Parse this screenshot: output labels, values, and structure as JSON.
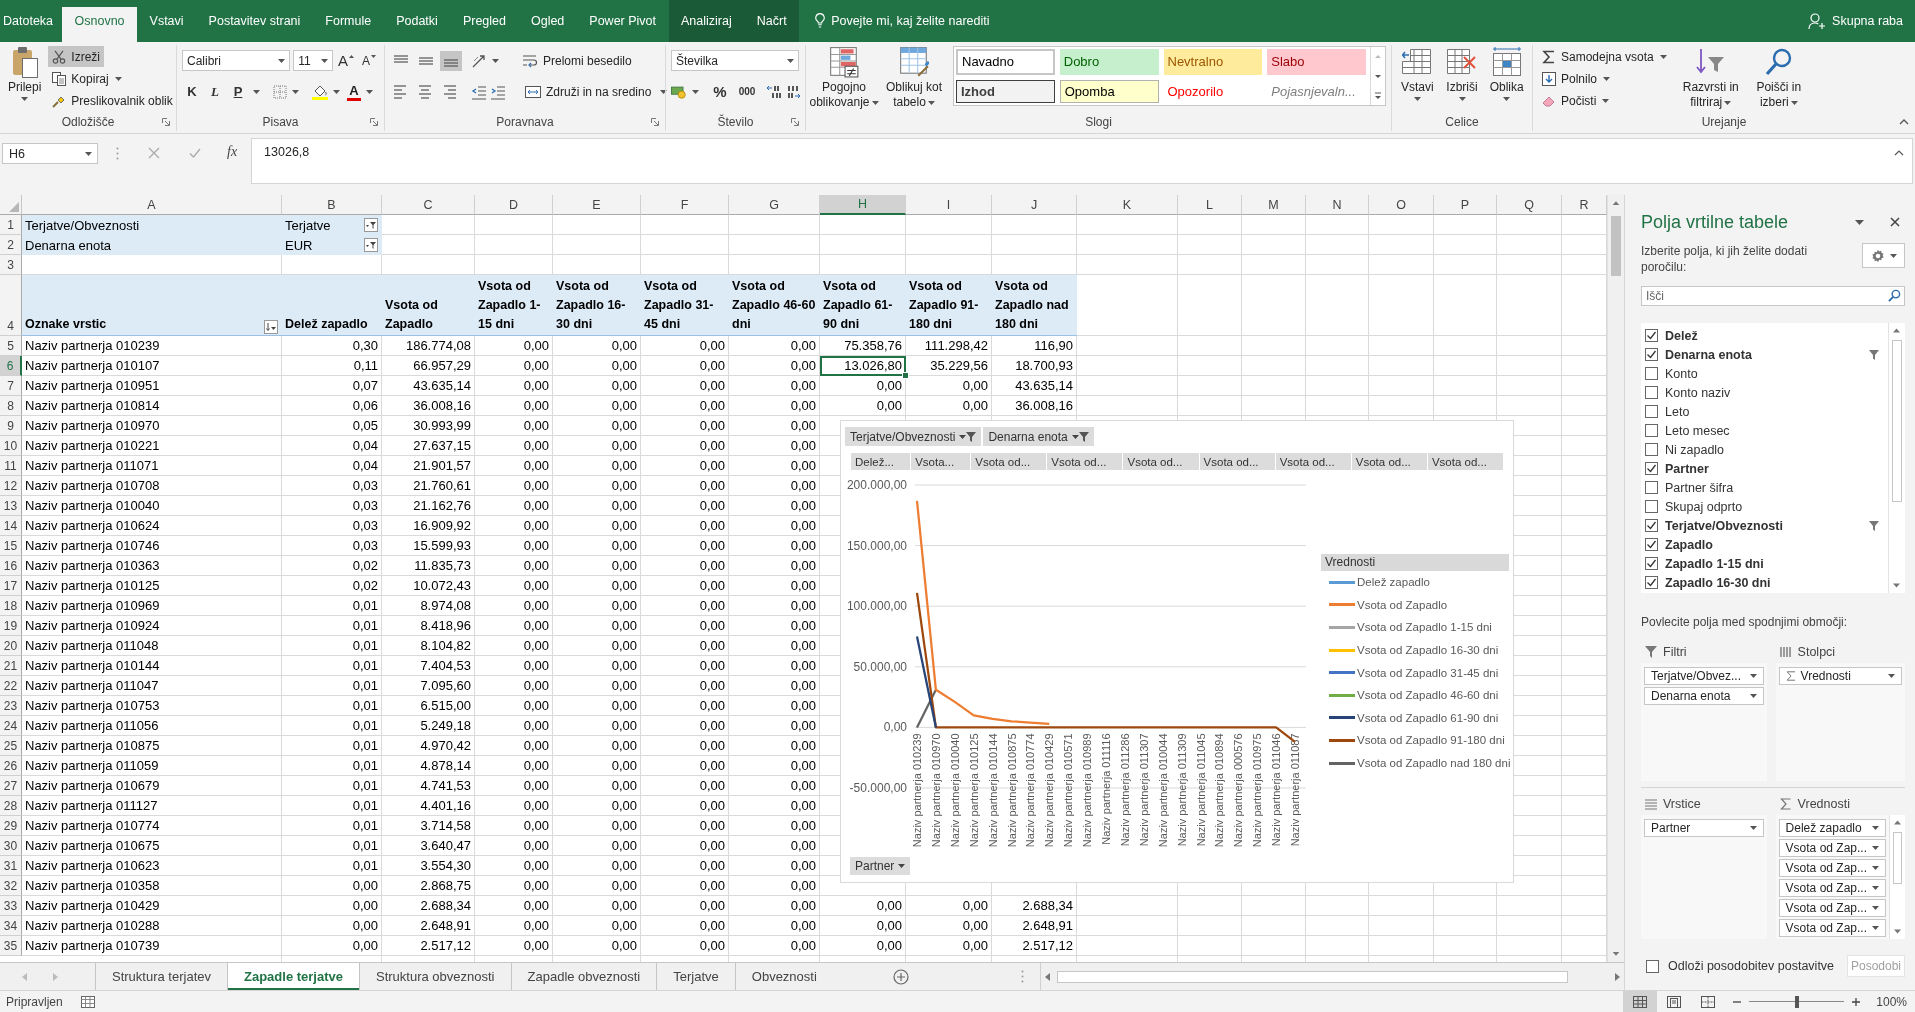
{
  "ribbon_tabs": [
    {
      "label": "Datoteka",
      "kind": "file",
      "selected": false
    },
    {
      "label": "Osnovno",
      "kind": "tab",
      "selected": true
    },
    {
      "label": "Vstavi",
      "kind": "tab",
      "selected": false
    },
    {
      "label": "Postavitev strani",
      "kind": "tab",
      "selected": false
    },
    {
      "label": "Formule",
      "kind": "tab",
      "selected": false
    },
    {
      "label": "Podatki",
      "kind": "tab",
      "selected": false
    },
    {
      "label": "Pregled",
      "kind": "tab",
      "selected": false
    },
    {
      "label": "Ogled",
      "kind": "tab",
      "selected": false
    },
    {
      "label": "Power Pivot",
      "kind": "tab",
      "selected": false
    },
    {
      "label": "Analiziraj",
      "kind": "context",
      "selected": false
    },
    {
      "label": "Načrt",
      "kind": "context",
      "selected": false
    }
  ],
  "tell_me": {
    "placeholder": "Povejte mi, kaj želite narediti"
  },
  "share": "Skupna raba",
  "ribbon": {
    "clipboard": {
      "label": "Odložišče",
      "paste": "Prilepi",
      "cut": {
        "label": "Izreži",
        "selected": true
      },
      "copy": "Kopiraj",
      "format_painter": "Preslikovalnik oblik"
    },
    "font": {
      "label": "Pisava",
      "font_name": "Calibri",
      "font_size": "11",
      "grow": "A",
      "shrink": "A",
      "bold": "K",
      "italic": "L",
      "underline": "P",
      "font_color": "A"
    },
    "alignment": {
      "label": "Poravnava",
      "vertical": [
        {
          "kind": "top",
          "selected": false
        },
        {
          "kind": "middle",
          "selected": false
        },
        {
          "kind": "bottom",
          "selected": true
        }
      ],
      "wrap": "Prelomi besedilo",
      "horizontal": [
        {
          "kind": "left"
        },
        {
          "kind": "center"
        },
        {
          "kind": "right"
        }
      ],
      "merge": "Združi in na sredino"
    },
    "number": {
      "label": "Število",
      "format": "Številka",
      "percent": "%",
      "thousands": "000"
    },
    "styles": {
      "label": "Slogi",
      "conditional": "Pogojno oblikovanje",
      "as_table": "Oblikuj kot tabelo",
      "cell_styles": [
        {
          "label": "Navadno",
          "kind": "normal"
        },
        {
          "label": "Dobro",
          "kind": "good"
        },
        {
          "label": "Nevtralno",
          "kind": "neutral"
        },
        {
          "label": "Slabo",
          "kind": "bad"
        },
        {
          "label": "Izhod",
          "kind": "output"
        },
        {
          "label": "Opomba",
          "kind": "note"
        },
        {
          "label": "Opozorilo",
          "kind": "warning"
        },
        {
          "label": "Pojasnjevaln...",
          "kind": "explanatory"
        }
      ]
    },
    "cells": {
      "label": "Celice",
      "buttons": [
        {
          "label": "Vstavi",
          "kind": "insert"
        },
        {
          "label": "Izbriši",
          "kind": "delete"
        },
        {
          "label": "Oblika",
          "kind": "format"
        }
      ]
    },
    "editing": {
      "label": "Urejanje",
      "autosum": "Samodejna vsota",
      "fill": "Polnilo",
      "clear": "Počisti",
      "sort": "Razvrsti in filtriraj",
      "find": "Poišči in izberi"
    }
  },
  "formula_bar": {
    "name_box": "H6",
    "function_label": "fx",
    "value": "13026,8"
  },
  "sheet": {
    "columns": [
      {
        "label": "A",
        "selected": false
      },
      {
        "label": "B",
        "selected": false
      },
      {
        "label": "C",
        "selected": false
      },
      {
        "label": "D",
        "selected": false
      },
      {
        "label": "E",
        "selected": false
      },
      {
        "label": "F",
        "selected": false
      },
      {
        "label": "G",
        "selected": false
      },
      {
        "label": "H",
        "selected": true
      },
      {
        "label": "I",
        "selected": false
      },
      {
        "label": "J",
        "selected": false
      },
      {
        "label": "K",
        "selected": false
      },
      {
        "label": "L",
        "selected": false
      },
      {
        "label": "M",
        "selected": false
      },
      {
        "label": "N",
        "selected": false
      },
      {
        "label": "O",
        "selected": false
      },
      {
        "label": "P",
        "selected": false
      },
      {
        "label": "Q",
        "selected": false
      },
      {
        "label": "R",
        "selected": false
      }
    ],
    "rows": [
      {
        "num": "1",
        "kind": "filter",
        "selected": false,
        "cells": [
          "Terjatve/Obveznosti",
          "Terjatve"
        ]
      },
      {
        "num": "2",
        "kind": "filter",
        "selected": false,
        "cells": [
          "Denarna enota",
          "EUR"
        ]
      },
      {
        "num": "3",
        "kind": "blank",
        "selected": false
      },
      {
        "num": "4",
        "kind": "header",
        "selected": false,
        "cells": [
          "Oznake vrstic",
          "Delež zapadlo",
          "Vsota od Zapadlo",
          "Vsota od Zapadlo 1-15 dni",
          "Vsota od Zapadlo 16-30 dni",
          "Vsota od Zapadlo 31-45 dni",
          "Vsota od Zapadlo 46-60 dni",
          "Vsota od Zapadlo 61-90 dni",
          "Vsota od Zapadlo 91-180 dni",
          "Vsota od Zapadlo nad 180 dni"
        ]
      },
      {
        "num": "5",
        "kind": "data",
        "selected": false,
        "cells": [
          "Naziv partnerja 010239",
          "0,30",
          "186.774,08",
          "0,00",
          "0,00",
          "0,00",
          "0,00",
          "75.358,76",
          "111.298,42",
          "116,90"
        ]
      },
      {
        "num": "6",
        "kind": "data",
        "selected": true,
        "cells": [
          "Naziv partnerja 010107",
          "0,11",
          "66.957,29",
          "0,00",
          "0,00",
          "0,00",
          "0,00",
          "13.026,80",
          "35.229,56",
          "18.700,93"
        ]
      },
      {
        "num": "7",
        "kind": "data",
        "selected": false,
        "cells": [
          "Naziv partnerja 010951",
          "0,07",
          "43.635,14",
          "0,00",
          "0,00",
          "0,00",
          "0,00",
          "0,00",
          "0,00",
          "43.635,14"
        ]
      },
      {
        "num": "8",
        "kind": "data",
        "selected": false,
        "cells": [
          "Naziv partnerja 010814",
          "0,06",
          "36.008,16",
          "0,00",
          "0,00",
          "0,00",
          "0,00",
          "0,00",
          "0,00",
          "36.008,16"
        ]
      },
      {
        "num": "9",
        "kind": "data",
        "selected": false,
        "cells": [
          "Naziv partnerja 010970",
          "0,05",
          "30.993,99",
          "0,00",
          "0,00",
          "0,00",
          "0,00"
        ]
      },
      {
        "num": "10",
        "kind": "data",
        "selected": false,
        "cells": [
          "Naziv partnerja 010221",
          "0,04",
          "27.637,15",
          "0,00",
          "0,00",
          "0,00",
          "0,00"
        ]
      },
      {
        "num": "11",
        "kind": "data",
        "selected": false,
        "cells": [
          "Naziv partnerja 011071",
          "0,04",
          "21.901,57",
          "0,00",
          "0,00",
          "0,00",
          "0,00"
        ]
      },
      {
        "num": "12",
        "kind": "data",
        "selected": false,
        "cells": [
          "Naziv partnerja 010708",
          "0,03",
          "21.760,61",
          "0,00",
          "0,00",
          "0,00",
          "0,00"
        ]
      },
      {
        "num": "13",
        "kind": "data",
        "selected": false,
        "cells": [
          "Naziv partnerja 010040",
          "0,03",
          "21.162,76",
          "0,00",
          "0,00",
          "0,00",
          "0,00"
        ]
      },
      {
        "num": "14",
        "kind": "data",
        "selected": false,
        "cells": [
          "Naziv partnerja 010624",
          "0,03",
          "16.909,92",
          "0,00",
          "0,00",
          "0,00",
          "0,00"
        ]
      },
      {
        "num": "15",
        "kind": "data",
        "selected": false,
        "cells": [
          "Naziv partnerja 010746",
          "0,03",
          "15.599,93",
          "0,00",
          "0,00",
          "0,00",
          "0,00"
        ]
      },
      {
        "num": "16",
        "kind": "data",
        "selected": false,
        "cells": [
          "Naziv partnerja 010363",
          "0,02",
          "11.835,73",
          "0,00",
          "0,00",
          "0,00",
          "0,00"
        ]
      },
      {
        "num": "17",
        "kind": "data",
        "selected": false,
        "cells": [
          "Naziv partnerja 010125",
          "0,02",
          "10.072,43",
          "0,00",
          "0,00",
          "0,00",
          "0,00"
        ]
      },
      {
        "num": "18",
        "kind": "data",
        "selected": false,
        "cells": [
          "Naziv partnerja 010969",
          "0,01",
          "8.974,08",
          "0,00",
          "0,00",
          "0,00",
          "0,00"
        ]
      },
      {
        "num": "19",
        "kind": "data",
        "selected": false,
        "cells": [
          "Naziv partnerja 010924",
          "0,01",
          "8.418,96",
          "0,00",
          "0,00",
          "0,00",
          "0,00"
        ]
      },
      {
        "num": "20",
        "kind": "data",
        "selected": false,
        "cells": [
          "Naziv partnerja 011048",
          "0,01",
          "8.104,82",
          "0,00",
          "0,00",
          "0,00",
          "0,00"
        ]
      },
      {
        "num": "21",
        "kind": "data",
        "selected": false,
        "cells": [
          "Naziv partnerja 010144",
          "0,01",
          "7.404,53",
          "0,00",
          "0,00",
          "0,00",
          "0,00"
        ]
      },
      {
        "num": "22",
        "kind": "data",
        "selected": false,
        "cells": [
          "Naziv partnerja 011047",
          "0,01",
          "7.095,60",
          "0,00",
          "0,00",
          "0,00",
          "0,00"
        ]
      },
      {
        "num": "23",
        "kind": "data",
        "selected": false,
        "cells": [
          "Naziv partnerja 010753",
          "0,01",
          "6.515,00",
          "0,00",
          "0,00",
          "0,00",
          "0,00"
        ]
      },
      {
        "num": "24",
        "kind": "data",
        "selected": false,
        "cells": [
          "Naziv partnerja 011056",
          "0,01",
          "5.249,18",
          "0,00",
          "0,00",
          "0,00",
          "0,00"
        ]
      },
      {
        "num": "25",
        "kind": "data",
        "selected": false,
        "cells": [
          "Naziv partnerja 010875",
          "0,01",
          "4.970,42",
          "0,00",
          "0,00",
          "0,00",
          "0,00"
        ]
      },
      {
        "num": "26",
        "kind": "data",
        "selected": false,
        "cells": [
          "Naziv partnerja 011059",
          "0,01",
          "4.878,14",
          "0,00",
          "0,00",
          "0,00",
          "0,00"
        ]
      },
      {
        "num": "27",
        "kind": "data",
        "selected": false,
        "cells": [
          "Naziv partnerja 010679",
          "0,01",
          "4.741,53",
          "0,00",
          "0,00",
          "0,00",
          "0,00"
        ]
      },
      {
        "num": "28",
        "kind": "data",
        "selected": false,
        "cells": [
          "Naziv partnerja 011127",
          "0,01",
          "4.401,16",
          "0,00",
          "0,00",
          "0,00",
          "0,00"
        ]
      },
      {
        "num": "29",
        "kind": "data",
        "selected": false,
        "cells": [
          "Naziv partnerja 010774",
          "0,01",
          "3.714,58",
          "0,00",
          "0,00",
          "0,00",
          "0,00"
        ]
      },
      {
        "num": "30",
        "kind": "data",
        "selected": false,
        "cells": [
          "Naziv partnerja 010675",
          "0,01",
          "3.640,47",
          "0,00",
          "0,00",
          "0,00",
          "0,00"
        ]
      },
      {
        "num": "31",
        "kind": "data",
        "selected": false,
        "cells": [
          "Naziv partnerja 010623",
          "0,01",
          "3.554,30",
          "0,00",
          "0,00",
          "0,00",
          "0,00"
        ]
      },
      {
        "num": "32",
        "kind": "data",
        "selected": false,
        "cells": [
          "Naziv partnerja 010358",
          "0,00",
          "2.868,75",
          "0,00",
          "0,00",
          "0,00",
          "0,00"
        ]
      },
      {
        "num": "33",
        "kind": "data",
        "selected": false,
        "cells": [
          "Naziv partnerja 010429",
          "0,00",
          "2.688,34",
          "0,00",
          "0,00",
          "0,00",
          "0,00",
          "0,00",
          "0,00",
          "2.688,34"
        ]
      },
      {
        "num": "34",
        "kind": "data",
        "selected": false,
        "cells": [
          "Naziv partnerja 010288",
          "0,00",
          "2.648,91",
          "0,00",
          "0,00",
          "0,00",
          "0,00",
          "0,00",
          "0,00",
          "2.648,91"
        ]
      },
      {
        "num": "35",
        "kind": "data",
        "selected": false,
        "cells": [
          "Naziv partnerja 010739",
          "0,00",
          "2.517,12",
          "0,00",
          "0,00",
          "0,00",
          "0,00",
          "0,00",
          "0,00",
          "2.517,12"
        ]
      }
    ]
  },
  "pivot_chart": {
    "filter_buttons": [
      "Terjatve/Obveznosti",
      "Denarna enota"
    ],
    "value_buttons": [
      "Delež...",
      "Vsota...",
      "Vsota od...",
      "Vsota od...",
      "Vsota od...",
      "Vsota od...",
      "Vsota od...",
      "Vsota od...",
      "Vsota od..."
    ],
    "legend_title": "Vrednosti",
    "axis_button": "Partner",
    "chart_data": {
      "type": "line",
      "grid": true,
      "legend": "right",
      "categories": [
        "Naziv partnerja 010239",
        "Naziv partnerja 010970",
        "Naziv partnerja 010040",
        "Naziv partnerja 010125",
        "Naziv partnerja 010144",
        "Naziv partnerja 010875",
        "Naziv partnerja 010774",
        "Naziv partnerja 010429",
        "Naziv partnerja 010571",
        "Naziv partnerja 010989",
        "Naziv partnerja 011116",
        "Naziv partnerja 011286",
        "Naziv partnerja 011307",
        "Naziv partnerja 010044",
        "Naziv partnerja 011309",
        "Naziv partnerja 011045",
        "Naziv partnerja 010894",
        "Naziv partnerja 000576",
        "Naziv partnerja 010975",
        "Naziv partnerja 011046",
        "Naziv partnerja 011087"
      ],
      "series": [
        {
          "name": "Delež zapadlo",
          "color": "#5b9bd5",
          "values": [
            null,
            null,
            null,
            null,
            null,
            null,
            null,
            null,
            null,
            null,
            null,
            null,
            null,
            null,
            null,
            null,
            null,
            null,
            null,
            null,
            null
          ]
        },
        {
          "name": "Vsota od Zapadlo",
          "color": "#ed7d31",
          "values": [
            187000,
            31000,
            21000,
            10000,
            7000,
            5000,
            4000,
            3000,
            null,
            null,
            null,
            null,
            null,
            null,
            null,
            null,
            null,
            null,
            null,
            null,
            null
          ]
        },
        {
          "name": "Vsota od Zapadlo 1-15 dni",
          "color": "#a5a5a5",
          "values": [
            null,
            null,
            null,
            null,
            null,
            null,
            null,
            null,
            null,
            null,
            null,
            null,
            null,
            null,
            null,
            null,
            null,
            null,
            null,
            null,
            null
          ]
        },
        {
          "name": "Vsota od Zapadlo 16-30 dni",
          "color": "#ffc000",
          "values": [
            null,
            null,
            null,
            null,
            null,
            null,
            null,
            null,
            null,
            null,
            null,
            null,
            null,
            null,
            null,
            null,
            null,
            null,
            null,
            null,
            null
          ]
        },
        {
          "name": "Vsota od Zapadlo 31-45 dni",
          "color": "#4472c4",
          "values": [
            null,
            null,
            null,
            null,
            null,
            null,
            null,
            null,
            null,
            null,
            null,
            null,
            null,
            null,
            null,
            null,
            null,
            null,
            null,
            null,
            null
          ]
        },
        {
          "name": "Vsota od Zapadlo 46-60 dni",
          "color": "#70ad47",
          "values": [
            null,
            null,
            null,
            null,
            null,
            null,
            null,
            null,
            null,
            null,
            null,
            null,
            null,
            null,
            null,
            null,
            null,
            null,
            null,
            null,
            null
          ]
        },
        {
          "name": "Vsota od Zapadlo 61-90 dni",
          "color": "#264478",
          "values": [
            75000,
            0,
            null,
            null,
            null,
            null,
            null,
            null,
            null,
            null,
            null,
            null,
            null,
            null,
            null,
            null,
            null,
            null,
            null,
            null,
            null
          ]
        },
        {
          "name": "Vsota od Zapadlo 91-180 dni",
          "color": "#9e480e",
          "values": [
            111000,
            0,
            0,
            0,
            0,
            0,
            0,
            0,
            0,
            0,
            0,
            0,
            0,
            0,
            0,
            0,
            0,
            0,
            0,
            0,
            -12000
          ]
        },
        {
          "name": "Vsota od Zapadlo nad 180 dni",
          "color": "#636363",
          "values": [
            0,
            31000,
            null,
            null,
            null,
            null,
            null,
            null,
            null,
            null,
            null,
            null,
            null,
            null,
            null,
            null,
            null,
            null,
            null,
            null,
            null
          ]
        }
      ],
      "ylim": [
        -50000,
        200000
      ],
      "yticks": [
        {
          "value": -50000,
          "label": "-50.000,00"
        },
        {
          "value": 0,
          "label": "0,00"
        },
        {
          "value": 50000,
          "label": "50.000,00"
        },
        {
          "value": 100000,
          "label": "100.000,00"
        },
        {
          "value": 150000,
          "label": "150.000,00"
        },
        {
          "value": 200000,
          "label": "200.000,00"
        }
      ]
    }
  },
  "sheet_tabs": [
    {
      "label": "Struktura terjatev",
      "selected": false
    },
    {
      "label": "Zapadle terjatve",
      "selected": true
    },
    {
      "label": "Struktura obveznosti",
      "selected": false
    },
    {
      "label": "Zapadle obveznosti",
      "selected": false
    },
    {
      "label": "Terjatve",
      "selected": false
    },
    {
      "label": "Obveznosti",
      "selected": false
    }
  ],
  "field_pane": {
    "title": "Polja vrtilne tabele",
    "prompt": "Izberite polja, ki jih želite dodati poročilu:",
    "search": {
      "placeholder": "Išči"
    },
    "fields": [
      {
        "label": "Delež",
        "checked": true,
        "filtered": false
      },
      {
        "label": "Denarna enota",
        "checked": true,
        "filtered": true
      },
      {
        "label": "Konto",
        "checked": false,
        "filtered": false
      },
      {
        "label": "Konto naziv",
        "checked": false,
        "filtered": false
      },
      {
        "label": "Leto",
        "checked": false,
        "filtered": false
      },
      {
        "label": "Leto mesec",
        "checked": false,
        "filtered": false
      },
      {
        "label": "Ni zapadlo",
        "checked": false,
        "filtered": false
      },
      {
        "label": "Partner",
        "checked": true,
        "filtered": false
      },
      {
        "label": "Partner šifra",
        "checked": false,
        "filtered": false
      },
      {
        "label": "Skupaj odprto",
        "checked": false,
        "filtered": false
      },
      {
        "label": "Terjatve/Obveznosti",
        "checked": true,
        "filtered": true
      },
      {
        "label": "Zapadlo",
        "checked": true,
        "filtered": false
      },
      {
        "label": "Zapadlo 1-15 dni",
        "checked": true,
        "filtered": false
      },
      {
        "label": "Zapadlo 16-30 dni",
        "checked": true,
        "filtered": false
      }
    ],
    "drag_hint": "Povlecite polja med spodnjimi območji:",
    "areas": [
      {
        "title": "Filtri",
        "kind": "filters",
        "items": [
          {
            "label": "Terjatve/Obvez...",
            "kind": "field"
          },
          {
            "label": "Denarna enota",
            "kind": "field"
          }
        ]
      },
      {
        "title": "Stolpci",
        "kind": "columns",
        "items": [
          {
            "label": "Vrednosti",
            "kind": "values"
          }
        ]
      },
      {
        "title": "Vrstice",
        "kind": "rows",
        "items": [
          {
            "label": "Partner",
            "kind": "field"
          }
        ]
      },
      {
        "title": "Vrednosti",
        "kind": "values",
        "items": [
          {
            "label": "Delež zapadlo",
            "kind": "field"
          },
          {
            "label": "Vsota od Zap...",
            "kind": "field"
          },
          {
            "label": "Vsota od Zap...",
            "kind": "field"
          },
          {
            "label": "Vsota od Zap...",
            "kind": "field"
          },
          {
            "label": "Vsota od Zap...",
            "kind": "field"
          },
          {
            "label": "Vsota od Zap...",
            "kind": "field"
          }
        ]
      }
    ],
    "defer": {
      "label": "Odloži posodobitev postavitve",
      "checked": false
    },
    "update": {
      "label": "Posodobi",
      "disabled": true
    }
  },
  "status_bar": {
    "status": "Pripravljen",
    "views": [
      {
        "kind": "normal",
        "selected": true
      },
      {
        "kind": "page_layout",
        "selected": false
      },
      {
        "kind": "page_break",
        "selected": false
      }
    ],
    "zoom": {
      "level": 0.5,
      "label": "100%"
    }
  }
}
